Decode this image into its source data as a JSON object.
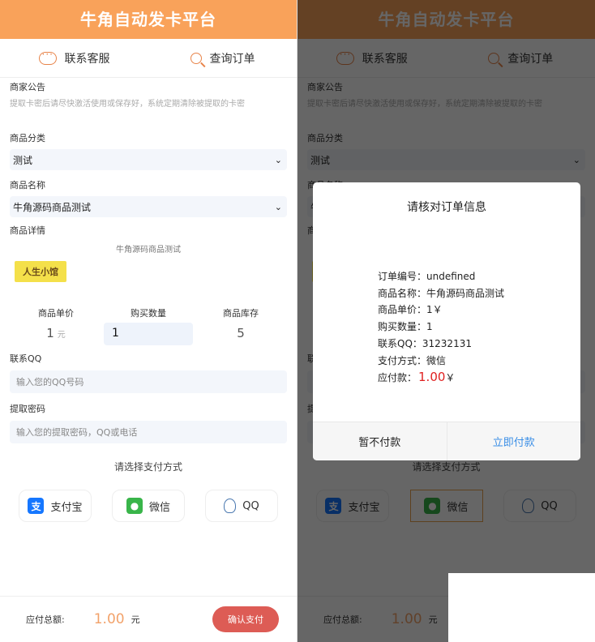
{
  "header": {
    "title": "牛角自动发卡平台"
  },
  "nav": {
    "contact": "联系客服",
    "query": "查询订单"
  },
  "notice": {
    "label": "商家公告",
    "text": "提取卡密后请尽快激活使用或保存好，系统定期清除被提取的卡密"
  },
  "category": {
    "label": "商品分类",
    "value": "测试"
  },
  "product": {
    "label": "商品名称",
    "value": "牛角源码商品测试"
  },
  "details": {
    "label": "商品详情",
    "text": "牛角源码商品测试",
    "logo_text": "人生小馆"
  },
  "pricing": {
    "price_label": "商品单价",
    "price_value": "1",
    "price_unit": "元",
    "qty_label": "购买数量",
    "qty_value": "1",
    "stock_label": "商品库存",
    "stock_value": "5"
  },
  "contact_qq": {
    "label": "联系QQ",
    "placeholder": "输入您的QQ号码"
  },
  "password": {
    "label": "提取密码",
    "placeholder": "输入您的提取密码，QQ或电话"
  },
  "payment": {
    "title": "请选择支付方式",
    "methods": [
      {
        "label": "支付宝",
        "icon": "alipay-icon",
        "color": "#1677ff"
      },
      {
        "label": "微信",
        "icon": "wechat-icon",
        "color": "#39b54a"
      },
      {
        "label": "QQ",
        "icon": "qq-icon",
        "color": "#4a78b0"
      }
    ],
    "selected_right_panel": "微信"
  },
  "footer": {
    "total_label": "应付总额:",
    "total_value": "1.00",
    "total_unit": "元",
    "confirm_label": "确认支付"
  },
  "modal": {
    "title": "请核对订单信息",
    "order_no": "订单编号：undefined",
    "name": "商品名称：牛角源码商品测试",
    "price": "商品单价：1￥",
    "qty": "购买数量：1",
    "qq": "联系QQ：31232131",
    "method": "支付方式：微信",
    "amount_label": "应付款：",
    "amount_value": "1.00",
    "amount_unit": "￥",
    "cancel_label": "暂不付款",
    "ok_label": "立即付款"
  },
  "colors": {
    "header": "#f9a25a",
    "confirm": "#dd5c55",
    "amount": "#e02020",
    "ok_link": "#3a8ee6"
  }
}
